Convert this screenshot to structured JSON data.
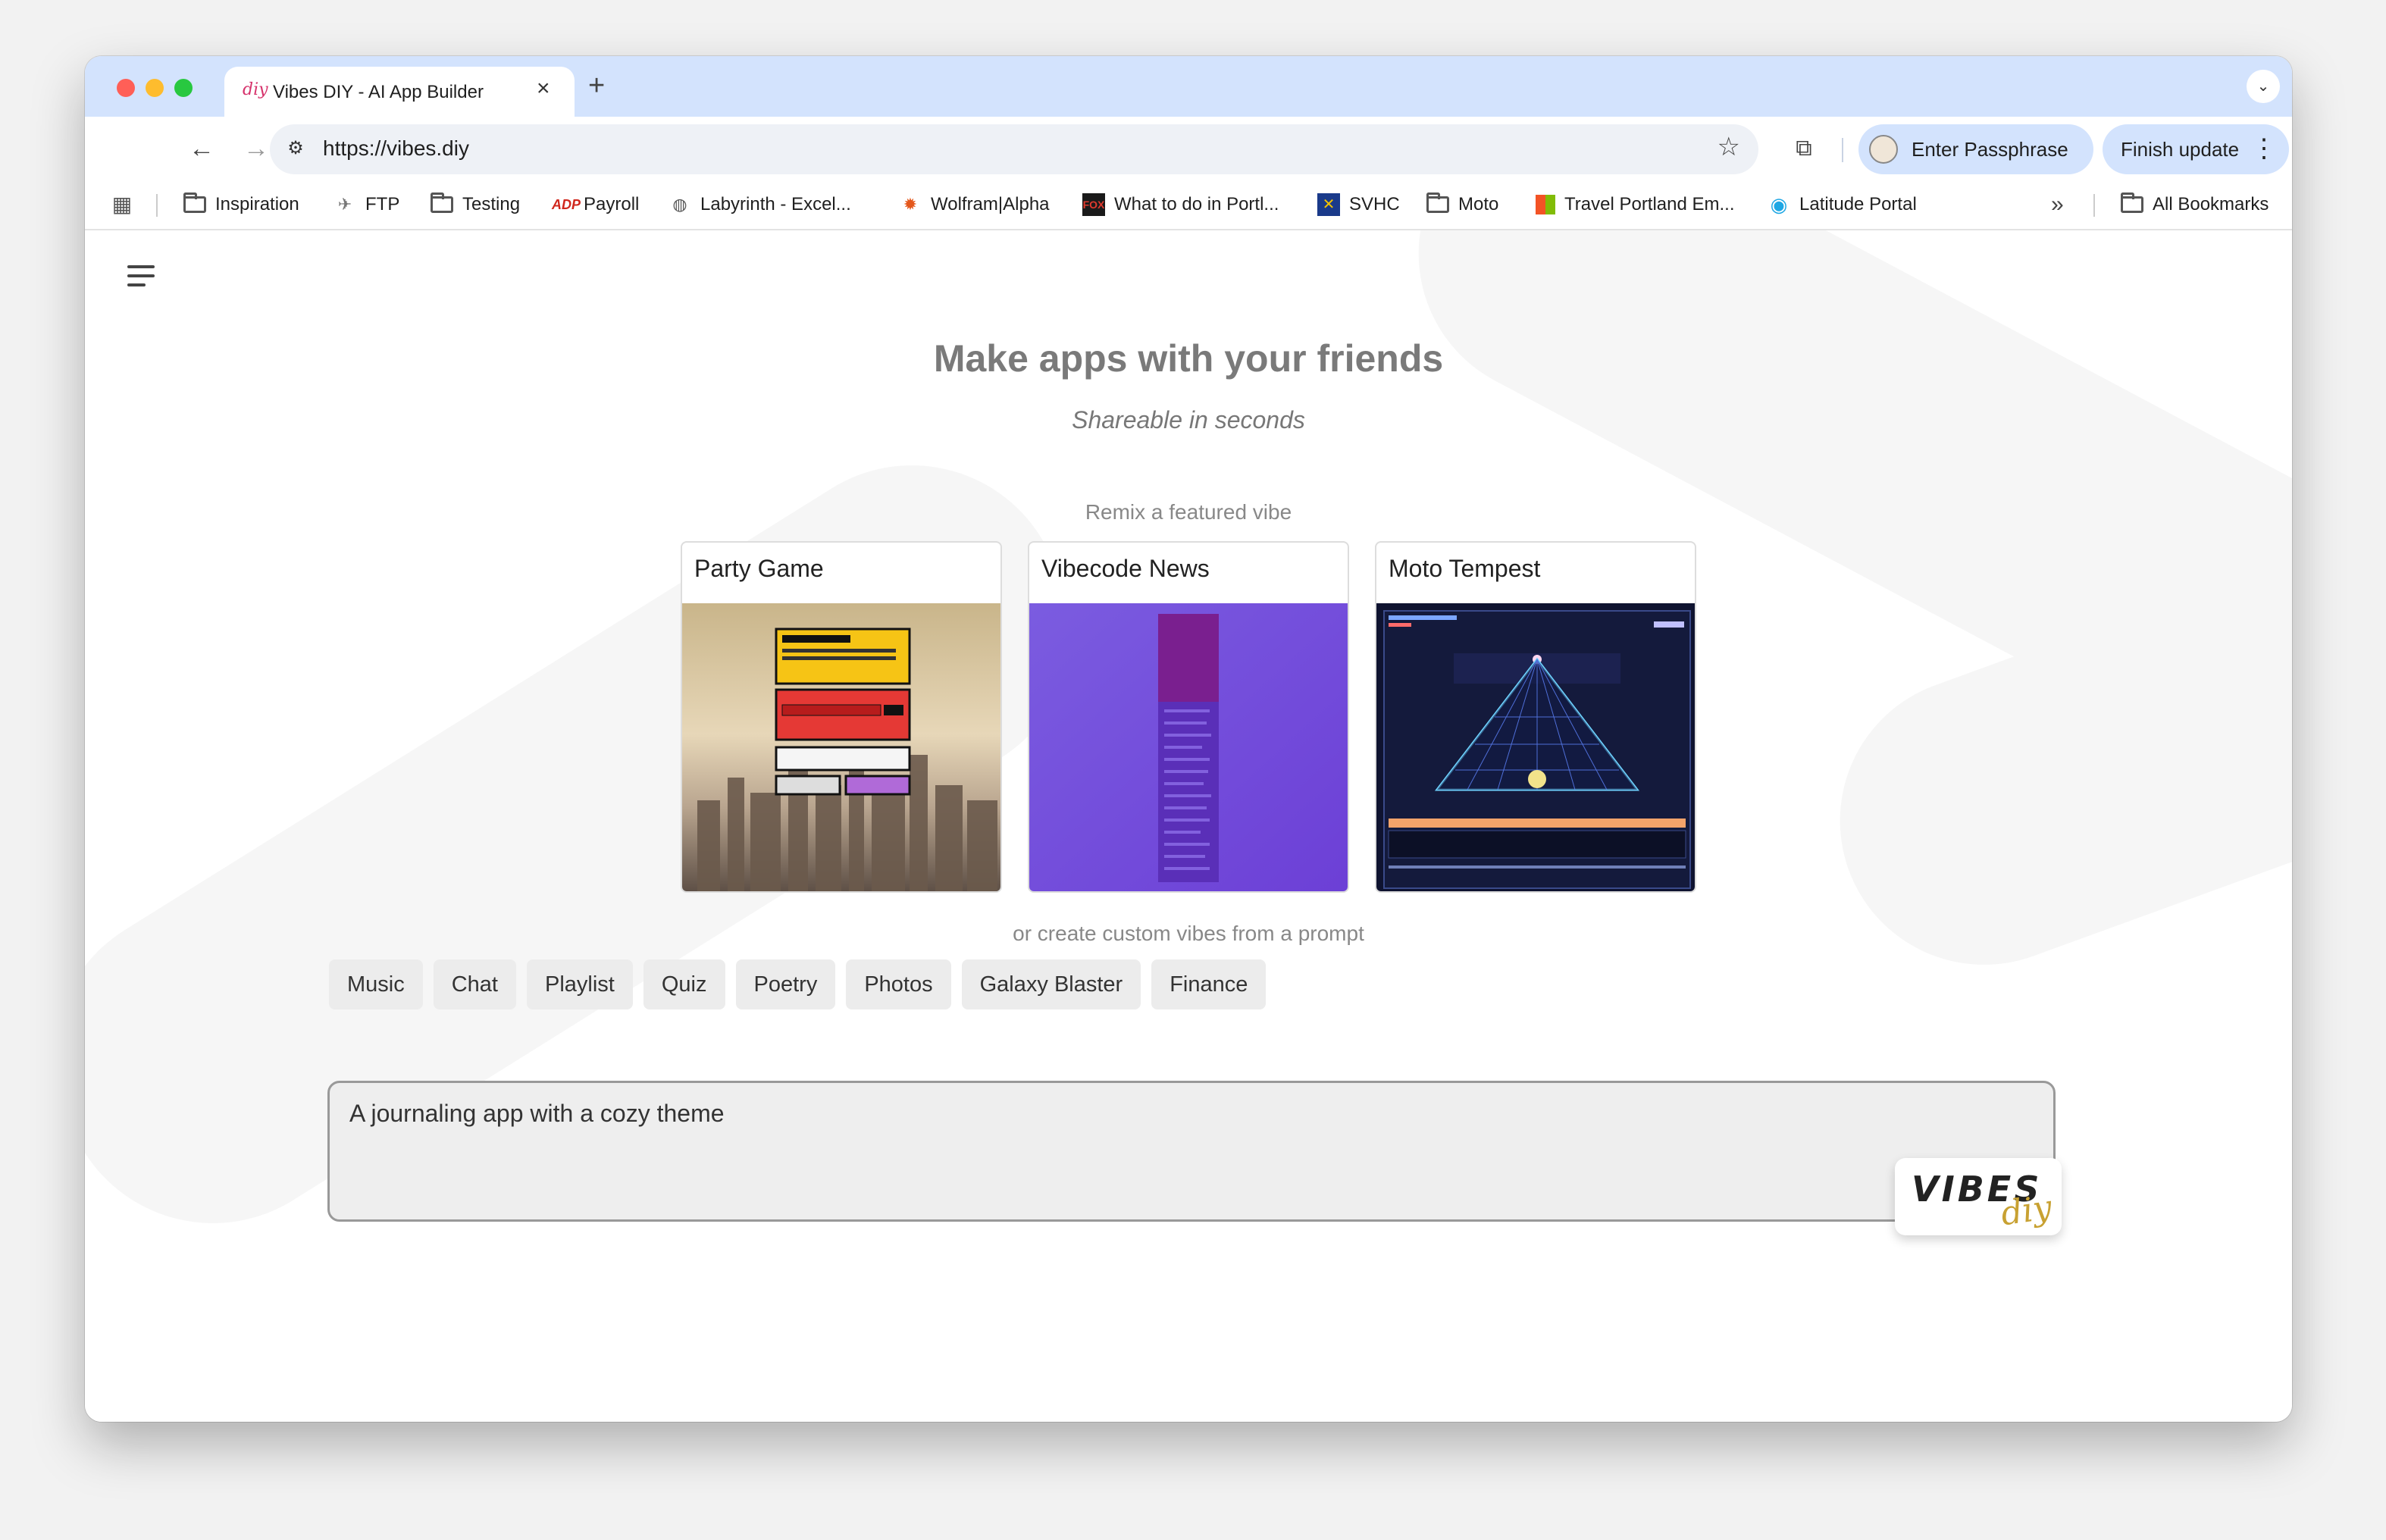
{
  "browser": {
    "tab_title": "Vibes DIY - AI App Builder",
    "tab_favicon": "diy",
    "url": "https://vibes.diy",
    "profile_button": "Enter Passphrase",
    "update_button": "Finish update"
  },
  "bookmarks": [
    {
      "label": "Inspiration",
      "icon": "folder-icon"
    },
    {
      "label": "FTP",
      "icon": "ftp-icon"
    },
    {
      "label": "Testing",
      "icon": "folder-icon"
    },
    {
      "label": "Payroll",
      "icon": "adp-icon"
    },
    {
      "label": "Labyrinth  - Excel...",
      "icon": "globe-icon"
    },
    {
      "label": "Wolfram|Alpha",
      "icon": "wolfram-icon"
    },
    {
      "label": "What to do in Portl...",
      "icon": "fox-icon"
    },
    {
      "label": "SVHC",
      "icon": "svhc-icon"
    },
    {
      "label": "Moto",
      "icon": "folder-icon"
    },
    {
      "label": "Travel Portland Em...",
      "icon": "microsoft-icon"
    },
    {
      "label": "Latitude Portal",
      "icon": "latitude-icon"
    }
  ],
  "all_bookmarks_label": "All Bookmarks",
  "overflow_glyph": "»",
  "hero": {
    "title": "Make apps with your friends",
    "subtitle": "Shareable in seconds"
  },
  "featured": {
    "label": "Remix a featured vibe",
    "cards": [
      {
        "title": "Party Game"
      },
      {
        "title": "Vibecode News"
      },
      {
        "title": "Moto Tempest"
      }
    ]
  },
  "create_label": "or create custom vibes from a prompt",
  "chips": [
    "Music",
    "Chat",
    "Playlist",
    "Quiz",
    "Poetry",
    "Photos",
    "Galaxy Blaster",
    "Finance"
  ],
  "prompt": {
    "value": "A journaling app with a cozy theme"
  },
  "logo": {
    "vibes": "VIBES",
    "diy": "diy"
  },
  "colors": {
    "tab_strip": "#d3e3fd",
    "chip_bg": "#ececec",
    "prompt_bg": "#eeeeee"
  }
}
